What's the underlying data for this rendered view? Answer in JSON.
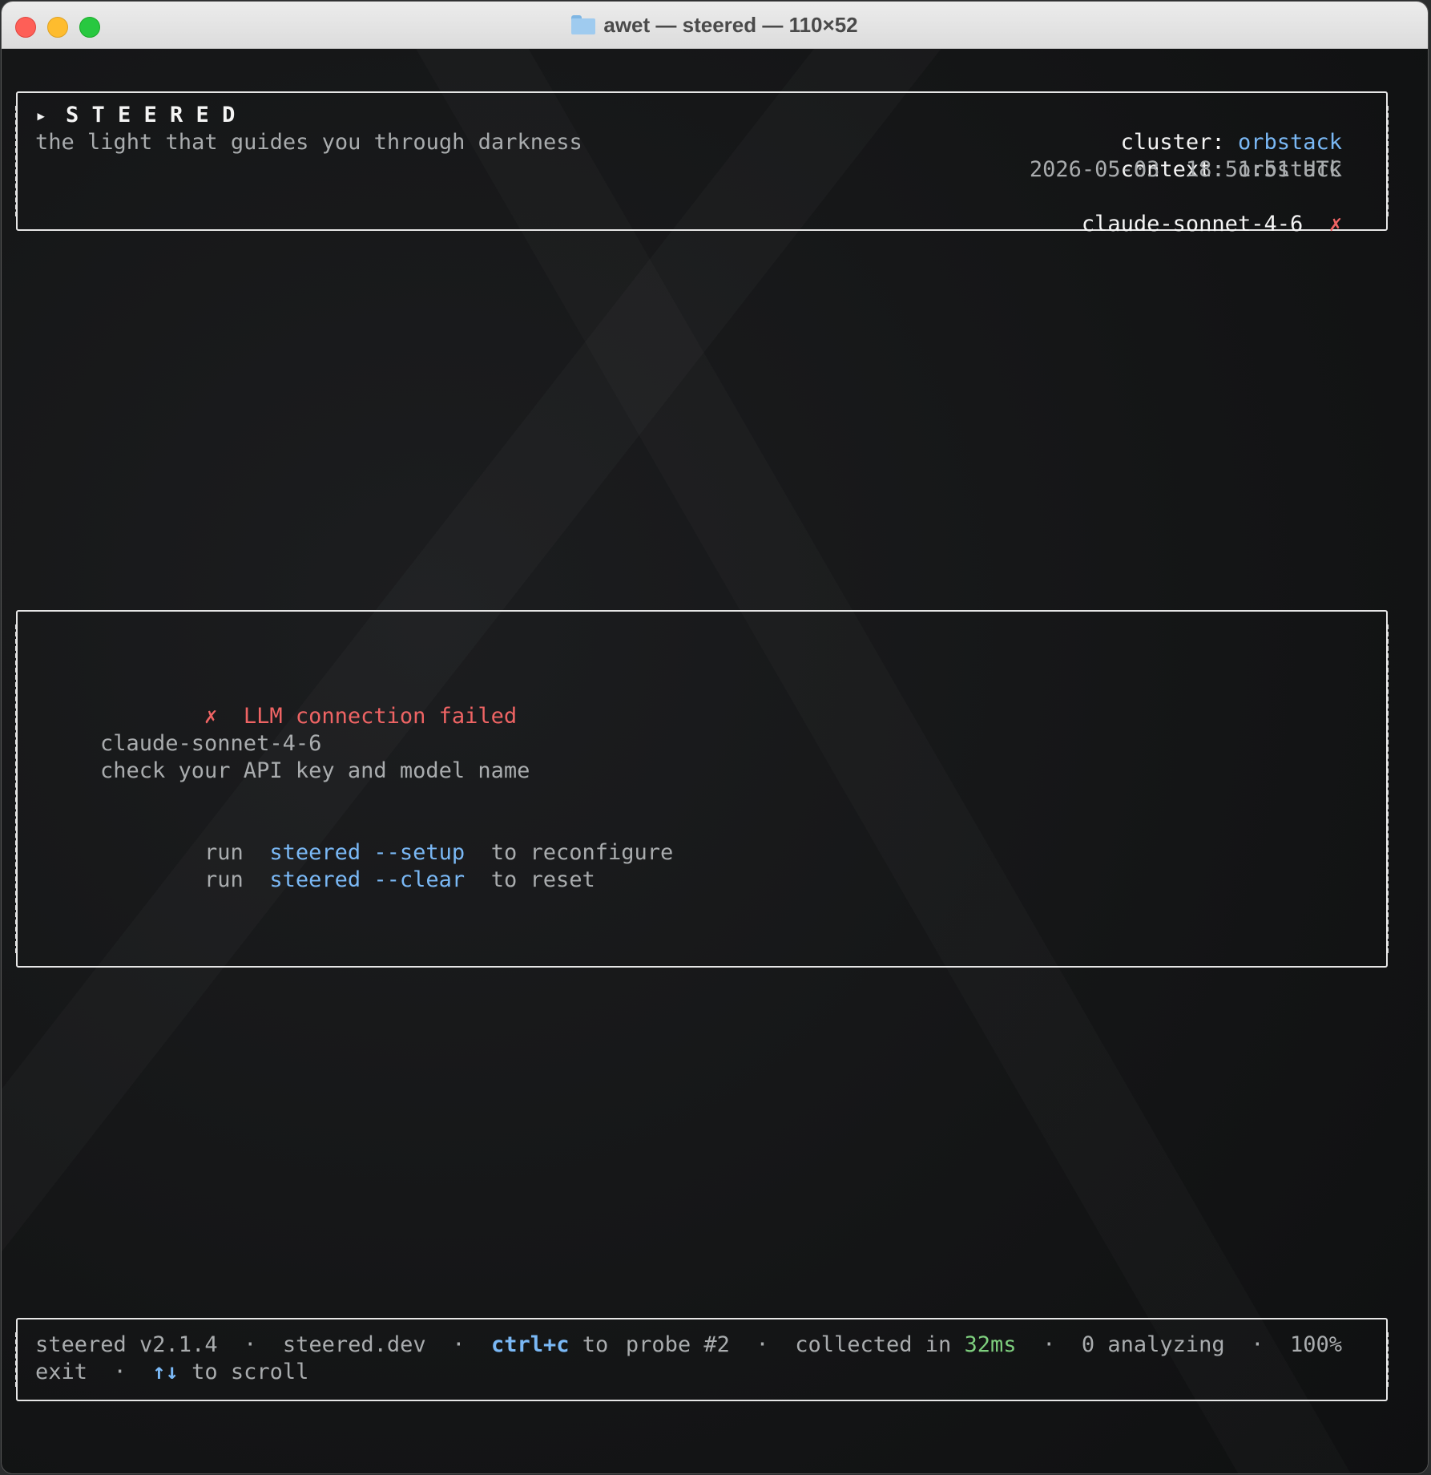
{
  "window": {
    "title": "awet — steered — 110×52",
    "folder_icon": "folder-icon"
  },
  "header": {
    "play_glyph": "▸",
    "brand": "S T E E R E D",
    "tagline": "the light that guides you through darkness",
    "cluster_label": "cluster:",
    "cluster_value": "orbstack",
    "context_label": "context:",
    "context_value": "orbstack",
    "datetime": "2026-05-03  18:51:51 UTC",
    "model": "claude-sonnet-4-6",
    "model_status_glyph": "✗"
  },
  "main": {
    "error_glyph": "✗",
    "error_title": "LLM connection failed",
    "model": "claude-sonnet-4-6",
    "hint": "check your API key and model name",
    "cmd1_prefix": "run",
    "cmd1": "steered --setup",
    "cmd1_suffix": "to reconfigure",
    "cmd2_prefix": "run",
    "cmd2": "steered --clear",
    "cmd2_suffix": "to reset"
  },
  "footer": {
    "version": "steered v2.1.4",
    "sep": "·",
    "site": "steered.dev",
    "ctrl_key": "ctrl+c",
    "ctrl_to": "to",
    "exit": "exit",
    "scroll_key": "↑↓",
    "scroll_text": "to scroll",
    "probe": "probe #2",
    "collected_label": "collected in",
    "collected_value": "32ms",
    "analyzing": "0 analyzing",
    "percent": "100%"
  },
  "colors": {
    "accent_blue": "#7ab8f5",
    "error_red": "#ef6464",
    "ok_green": "#7ecf7e"
  }
}
